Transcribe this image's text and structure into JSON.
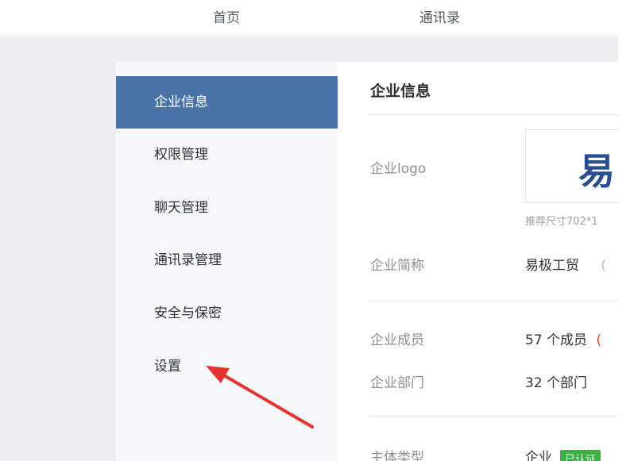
{
  "topnav": {
    "tabs": [
      {
        "label": "首页"
      },
      {
        "label": "通讯录"
      }
    ]
  },
  "sidebar": {
    "items": [
      {
        "label": "企业信息",
        "active": true
      },
      {
        "label": "权限管理"
      },
      {
        "label": "聊天管理"
      },
      {
        "label": "通讯录管理"
      },
      {
        "label": "安全与保密"
      },
      {
        "label": "设置"
      }
    ]
  },
  "main": {
    "title": "企业信息",
    "logo": {
      "label": "企业logo",
      "glyph": "易",
      "hint": "推荐尺寸702*1"
    },
    "short_name": {
      "label": "企业简称",
      "value": "易极工贸",
      "paren": "("
    },
    "members": {
      "label": "企业成员",
      "value": "57 个成员",
      "paren": "("
    },
    "departments": {
      "label": "企业部门",
      "value": "32 个部门"
    },
    "entity_type": {
      "label": "主体类型",
      "value": "企业",
      "badge": "已认证"
    }
  },
  "colors": {
    "accent": "#4a73a8",
    "annotation_arrow": "#e3342f",
    "verified_badge": "#3cb043"
  }
}
